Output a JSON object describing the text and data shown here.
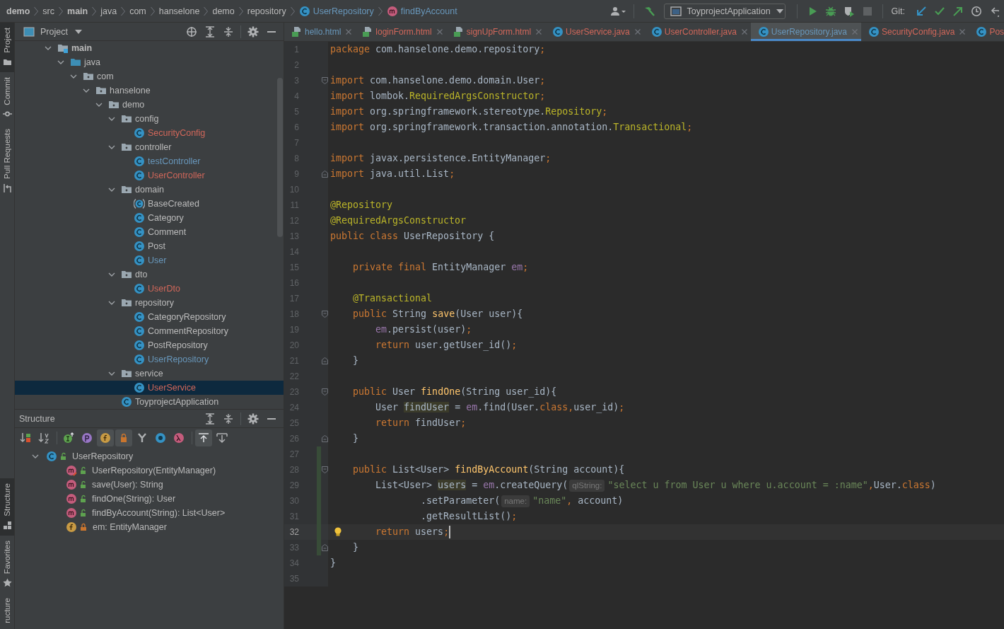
{
  "breadcrumbs": [
    {
      "label": "demo",
      "kind": "dir",
      "bold": true
    },
    {
      "label": "src",
      "kind": "dir",
      "bold": false
    },
    {
      "label": "main",
      "kind": "dir",
      "bold": true
    },
    {
      "label": "java",
      "kind": "dir",
      "bold": false
    },
    {
      "label": "com",
      "kind": "dir",
      "bold": false
    },
    {
      "label": "hanselone",
      "kind": "dir",
      "bold": false
    },
    {
      "label": "demo",
      "kind": "dir",
      "bold": false
    },
    {
      "label": "repository",
      "kind": "dir",
      "bold": false
    },
    {
      "label": "UserRepository",
      "kind": "class",
      "bold": false
    },
    {
      "label": "findByAccount",
      "kind": "method",
      "bold": false
    }
  ],
  "toolbar": [
    {
      "kind": "vcs-user",
      "disabled": false
    },
    {
      "kind": "build",
      "disabled": false
    },
    {
      "kind": "run-config",
      "label": "ToyprojectApplication",
      "disabled": false
    },
    {
      "kind": "run",
      "disabled": false
    },
    {
      "kind": "debug",
      "disabled": false
    },
    {
      "kind": "coverage",
      "disabled": false
    },
    {
      "kind": "stop",
      "disabled": true
    },
    {
      "kind": "git-label",
      "label": "Git:"
    },
    {
      "kind": "update",
      "disabled": false
    },
    {
      "kind": "commit",
      "disabled": false
    },
    {
      "kind": "push",
      "disabled": false
    },
    {
      "kind": "history",
      "disabled": false
    },
    {
      "kind": "rollback",
      "disabled": false
    }
  ],
  "tool_stripe": {
    "top": [
      {
        "label": "Project",
        "kind": "folder",
        "selected": true
      },
      {
        "label": "Commit",
        "kind": "commit",
        "selected": false
      },
      {
        "label": "Pull Requests",
        "kind": "pull",
        "selected": false
      }
    ],
    "bottom": [
      {
        "label": "Structure",
        "kind": "structure",
        "selected": true
      },
      {
        "label": "Favorites",
        "kind": "star",
        "selected": false
      },
      {
        "label": "ructure",
        "kind": "plain",
        "selected": false
      }
    ]
  },
  "project_panel": {
    "title": "Project",
    "tree": [
      {
        "label": "main",
        "kind": "module-folder",
        "color": "#bbbbbb",
        "selected": false,
        "expanded": true,
        "children": [
          {
            "label": "java",
            "kind": "source-root",
            "color": "#bbbbbb",
            "selected": false,
            "expanded": true,
            "children": [
              {
                "label": "com",
                "kind": "package",
                "color": "#bbbbbb",
                "selected": false,
                "expanded": true,
                "children": [
                  {
                    "label": "hanselone",
                    "kind": "package",
                    "color": "#bbbbbb",
                    "selected": false,
                    "expanded": true,
                    "children": [
                      {
                        "label": "demo",
                        "kind": "package",
                        "color": "#bbbbbb",
                        "selected": false,
                        "expanded": true,
                        "children": [
                          {
                            "label": "config",
                            "kind": "package",
                            "color": "#bbbbbb",
                            "selected": false,
                            "expanded": true,
                            "children": [
                              {
                                "label": "SecurityConfig",
                                "kind": "class",
                                "color": "#d1675a",
                                "selected": false
                              }
                            ]
                          },
                          {
                            "label": "controller",
                            "kind": "package",
                            "color": "#bbbbbb",
                            "selected": false,
                            "expanded": true,
                            "children": [
                              {
                                "label": "testController",
                                "kind": "class",
                                "color": "#6897bb",
                                "selected": false
                              },
                              {
                                "label": "UserController",
                                "kind": "class",
                                "color": "#d1675a",
                                "selected": false
                              }
                            ]
                          },
                          {
                            "label": "domain",
                            "kind": "package",
                            "color": "#bbbbbb",
                            "selected": false,
                            "expanded": true,
                            "children": [
                              {
                                "label": "BaseCreated",
                                "kind": "abstract-class",
                                "color": "#bbbbbb",
                                "selected": false
                              },
                              {
                                "label": "Category",
                                "kind": "class",
                                "color": "#bbbbbb",
                                "selected": false
                              },
                              {
                                "label": "Comment",
                                "kind": "class",
                                "color": "#bbbbbb",
                                "selected": false
                              },
                              {
                                "label": "Post",
                                "kind": "class",
                                "color": "#bbbbbb",
                                "selected": false
                              },
                              {
                                "label": "User",
                                "kind": "class",
                                "color": "#6897bb",
                                "selected": false
                              }
                            ]
                          },
                          {
                            "label": "dto",
                            "kind": "package",
                            "color": "#bbbbbb",
                            "selected": false,
                            "expanded": true,
                            "children": [
                              {
                                "label": "UserDto",
                                "kind": "class",
                                "color": "#d1675a",
                                "selected": false
                              }
                            ]
                          },
                          {
                            "label": "repository",
                            "kind": "package",
                            "color": "#bbbbbb",
                            "selected": false,
                            "expanded": true,
                            "children": [
                              {
                                "label": "CategoryRepository",
                                "kind": "class",
                                "color": "#bbbbbb",
                                "selected": false
                              },
                              {
                                "label": "CommentRepository",
                                "kind": "class",
                                "color": "#bbbbbb",
                                "selected": false
                              },
                              {
                                "label": "PostRepository",
                                "kind": "class",
                                "color": "#bbbbbb",
                                "selected": false
                              },
                              {
                                "label": "UserRepository",
                                "kind": "class",
                                "color": "#6897bb",
                                "selected": false
                              }
                            ]
                          },
                          {
                            "label": "service",
                            "kind": "package",
                            "color": "#bbbbbb",
                            "selected": false,
                            "expanded": true,
                            "children": [
                              {
                                "label": "UserService",
                                "kind": "class",
                                "color": "#d1675a",
                                "selected": true
                              }
                            ]
                          },
                          {
                            "label": "ToyprojectApplication",
                            "kind": "app-class",
                            "color": "#bbbbbb",
                            "selected": false
                          }
                        ]
                      }
                    ]
                  }
                ]
              }
            ]
          }
        ]
      }
    ]
  },
  "structure_panel": {
    "title": "Structure",
    "toolbar": [
      {
        "kind": "sort-visibility",
        "on": false
      },
      {
        "kind": "sort-alpha",
        "on": false
      },
      {
        "kind": "inherited",
        "on": false
      },
      {
        "kind": "properties",
        "on": false
      },
      {
        "kind": "fields",
        "on": true
      },
      {
        "kind": "non-public",
        "on": true
      },
      {
        "kind": "fork",
        "on": false
      },
      {
        "kind": "anonymous",
        "on": false
      },
      {
        "kind": "lambdas",
        "on": false
      },
      {
        "kind": "scroll-to-source",
        "on": true
      },
      {
        "kind": "scroll-from-source",
        "on": false
      }
    ],
    "tree": [
      {
        "label": "UserRepository",
        "kind": "class",
        "private": false,
        "selected": false,
        "expanded": true,
        "children": [
          {
            "label": "UserRepository(EntityManager)",
            "kind": "constructor",
            "private": false,
            "selected": false
          },
          {
            "label": "save(User): String",
            "kind": "method",
            "private": false,
            "selected": false
          },
          {
            "label": "findOne(String): User",
            "kind": "method",
            "private": false,
            "selected": false
          },
          {
            "label": "findByAccount(String): List<User>",
            "kind": "method",
            "private": false,
            "selected": false
          },
          {
            "label": "em: EntityManager",
            "kind": "field",
            "private": true,
            "selected": false
          }
        ]
      }
    ]
  },
  "editor": {
    "tabs": [
      {
        "label": "hello.html",
        "kind": "html",
        "color": "#6897bb",
        "selected": false,
        "closable": true
      },
      {
        "label": "loginForm.html",
        "kind": "html",
        "color": "#d1675a",
        "selected": false,
        "closable": true
      },
      {
        "label": "signUpForm.html",
        "kind": "html",
        "color": "#d1675a",
        "selected": false,
        "closable": true
      },
      {
        "label": "UserService.java",
        "kind": "class",
        "color": "#d1675a",
        "selected": false,
        "closable": true
      },
      {
        "label": "UserController.java",
        "kind": "class",
        "color": "#d1675a",
        "selected": false,
        "closable": true
      },
      {
        "label": "UserRepository.java",
        "kind": "class",
        "color": "#6897bb",
        "selected": true,
        "closable": true
      },
      {
        "label": "SecurityConfig.java",
        "kind": "class",
        "color": "#d1675a",
        "selected": false,
        "closable": true
      },
      {
        "label": "Pos",
        "kind": "class",
        "color": "#d1675a",
        "selected": false,
        "closable": false
      }
    ],
    "lines": [
      {
        "n": "1",
        "current": false,
        "changed": false,
        "fold_start": false,
        "fold_end": false,
        "intention": false,
        "tokens": [
          {
            "kind": "kw",
            "text": "package "
          },
          {
            "kind": "p",
            "text": "com.hanselone.demo.repository"
          },
          {
            "kind": "kw",
            "text": ";"
          }
        ]
      },
      {
        "n": "2",
        "current": false,
        "changed": false,
        "fold_start": false,
        "fold_end": false,
        "intention": false
      },
      {
        "n": "3",
        "current": false,
        "changed": false,
        "fold_start": true,
        "fold_end": false,
        "intention": false,
        "tokens": [
          {
            "kind": "kw",
            "text": "import "
          },
          {
            "kind": "p",
            "text": "com.hanselone.demo.domain.User"
          },
          {
            "kind": "kw",
            "text": ";"
          }
        ]
      },
      {
        "n": "4",
        "current": false,
        "changed": false,
        "fold_start": false,
        "fold_end": false,
        "intention": false,
        "tokens": [
          {
            "kind": "kw",
            "text": "import "
          },
          {
            "kind": "p",
            "text": "lombok."
          },
          {
            "kind": "ann",
            "text": "RequiredArgsConstructor"
          },
          {
            "kind": "kw",
            "text": ";"
          }
        ]
      },
      {
        "n": "5",
        "current": false,
        "changed": false,
        "fold_start": false,
        "fold_end": false,
        "intention": false,
        "tokens": [
          {
            "kind": "kw",
            "text": "import "
          },
          {
            "kind": "p",
            "text": "org.springframework.stereotype."
          },
          {
            "kind": "ann",
            "text": "Repository"
          },
          {
            "kind": "kw",
            "text": ";"
          }
        ]
      },
      {
        "n": "6",
        "current": false,
        "changed": false,
        "fold_start": false,
        "fold_end": false,
        "intention": false,
        "tokens": [
          {
            "kind": "kw",
            "text": "import "
          },
          {
            "kind": "p",
            "text": "org.springframework.transaction.annotation."
          },
          {
            "kind": "ann",
            "text": "Transactional"
          },
          {
            "kind": "kw",
            "text": ";"
          }
        ]
      },
      {
        "n": "7",
        "current": false,
        "changed": false,
        "fold_start": false,
        "fold_end": false,
        "intention": false
      },
      {
        "n": "8",
        "current": false,
        "changed": false,
        "fold_start": false,
        "fold_end": false,
        "intention": false,
        "tokens": [
          {
            "kind": "kw",
            "text": "import "
          },
          {
            "kind": "p",
            "text": "javax.persistence.EntityManager"
          },
          {
            "kind": "kw",
            "text": ";"
          }
        ]
      },
      {
        "n": "9",
        "current": false,
        "changed": false,
        "fold_start": false,
        "fold_end": true,
        "intention": false,
        "tokens": [
          {
            "kind": "kw",
            "text": "import "
          },
          {
            "kind": "p",
            "text": "java.util.List"
          },
          {
            "kind": "kw",
            "text": ";"
          }
        ]
      },
      {
        "n": "10",
        "current": false,
        "changed": false,
        "fold_start": false,
        "fold_end": false,
        "intention": false
      },
      {
        "n": "11",
        "current": false,
        "changed": false,
        "fold_start": false,
        "fold_end": false,
        "intention": false,
        "tokens": [
          {
            "kind": "ann",
            "text": "@Repository"
          }
        ]
      },
      {
        "n": "12",
        "current": false,
        "changed": false,
        "fold_start": false,
        "fold_end": false,
        "intention": false,
        "tokens": [
          {
            "kind": "ann",
            "text": "@RequiredArgsConstructor"
          }
        ]
      },
      {
        "n": "13",
        "current": false,
        "changed": false,
        "fold_start": false,
        "fold_end": false,
        "intention": false,
        "tokens": [
          {
            "kind": "kw",
            "text": "public class "
          },
          {
            "kind": "p",
            "text": "UserRepository {"
          }
        ]
      },
      {
        "n": "14",
        "current": false,
        "changed": false,
        "fold_start": false,
        "fold_end": false,
        "intention": false
      },
      {
        "n": "15",
        "current": false,
        "changed": false,
        "fold_start": false,
        "fold_end": false,
        "intention": false,
        "tokens": [
          {
            "kind": "kw",
            "text": "    private final "
          },
          {
            "kind": "p",
            "text": "EntityManager "
          },
          {
            "kind": "fld",
            "text": "em"
          },
          {
            "kind": "kw",
            "text": ";"
          }
        ]
      },
      {
        "n": "16",
        "current": false,
        "changed": false,
        "fold_start": false,
        "fold_end": false,
        "intention": false
      },
      {
        "n": "17",
        "current": false,
        "changed": false,
        "fold_start": false,
        "fold_end": false,
        "intention": false,
        "tokens": [
          {
            "kind": "ann",
            "text": "    @Transactional"
          }
        ]
      },
      {
        "n": "18",
        "current": false,
        "changed": false,
        "fold_start": true,
        "fold_end": false,
        "intention": false,
        "tokens": [
          {
            "kind": "kw",
            "text": "    public "
          },
          {
            "kind": "p",
            "text": "String "
          },
          {
            "kind": "meth",
            "text": "save"
          },
          {
            "kind": "p",
            "text": "(User user){"
          }
        ]
      },
      {
        "n": "19",
        "current": false,
        "changed": false,
        "fold_start": false,
        "fold_end": false,
        "intention": false,
        "tokens": [
          {
            "kind": "fld",
            "text": "        em"
          },
          {
            "kind": "p",
            "text": ".persist(user)"
          },
          {
            "kind": "kw",
            "text": ";"
          }
        ]
      },
      {
        "n": "20",
        "current": false,
        "changed": false,
        "fold_start": false,
        "fold_end": false,
        "intention": false,
        "tokens": [
          {
            "kind": "kw",
            "text": "        return "
          },
          {
            "kind": "p",
            "text": "user.getUser_id()"
          },
          {
            "kind": "kw",
            "text": ";"
          }
        ]
      },
      {
        "n": "21",
        "current": false,
        "changed": false,
        "fold_start": false,
        "fold_end": true,
        "intention": false,
        "tokens": [
          {
            "kind": "p",
            "text": "    }"
          }
        ]
      },
      {
        "n": "22",
        "current": false,
        "changed": false,
        "fold_start": false,
        "fold_end": false,
        "intention": false
      },
      {
        "n": "23",
        "current": false,
        "changed": false,
        "fold_start": true,
        "fold_end": false,
        "intention": false,
        "tokens": [
          {
            "kind": "kw",
            "text": "    public "
          },
          {
            "kind": "p",
            "text": "User "
          },
          {
            "kind": "meth",
            "text": "findOne"
          },
          {
            "kind": "p",
            "text": "(String user_id){"
          }
        ]
      },
      {
        "n": "24",
        "current": false,
        "changed": false,
        "fold_start": false,
        "fold_end": false,
        "intention": false,
        "tokens": [
          {
            "kind": "p",
            "text": "        User "
          },
          {
            "kind": "hl",
            "text": "findUser"
          },
          {
            "kind": "p",
            "text": " = "
          },
          {
            "kind": "fld",
            "text": "em"
          },
          {
            "kind": "p",
            "text": ".find(User."
          },
          {
            "kind": "kw",
            "text": "class,"
          },
          {
            "kind": "p",
            "text": "user_id)"
          },
          {
            "kind": "kw",
            "text": ";"
          }
        ]
      },
      {
        "n": "25",
        "current": false,
        "changed": false,
        "fold_start": false,
        "fold_end": false,
        "intention": false,
        "tokens": [
          {
            "kind": "kw",
            "text": "        return "
          },
          {
            "kind": "p",
            "text": "findUser"
          },
          {
            "kind": "kw",
            "text": ";"
          }
        ]
      },
      {
        "n": "26",
        "current": false,
        "changed": false,
        "fold_start": false,
        "fold_end": true,
        "intention": false,
        "tokens": [
          {
            "kind": "p",
            "text": "    }"
          }
        ]
      },
      {
        "n": "27",
        "current": false,
        "changed": true,
        "fold_start": false,
        "fold_end": false,
        "intention": false
      },
      {
        "n": "28",
        "current": false,
        "changed": true,
        "fold_start": true,
        "fold_end": false,
        "intention": false,
        "tokens": [
          {
            "kind": "kw",
            "text": "    public "
          },
          {
            "kind": "p",
            "text": "List<User> "
          },
          {
            "kind": "meth",
            "text": "findByAccount"
          },
          {
            "kind": "p",
            "text": "(String account){"
          }
        ]
      },
      {
        "n": "29",
        "current": false,
        "changed": true,
        "fold_start": false,
        "fold_end": false,
        "intention": false,
        "tokens": [
          {
            "kind": "p",
            "text": "        List<User> "
          },
          {
            "kind": "hl",
            "text": "users"
          },
          {
            "kind": "p",
            "text": " = "
          },
          {
            "kind": "fld",
            "text": "em"
          },
          {
            "kind": "p",
            "text": ".createQuery("
          },
          {
            "kind": "hint",
            "text": "qlString:"
          },
          {
            "kind": "str",
            "text": "\"select u from User u where u.account = :name\""
          },
          {
            "kind": "kw",
            "text": ","
          },
          {
            "kind": "p",
            "text": "User."
          },
          {
            "kind": "kw",
            "text": "class"
          },
          {
            "kind": "p",
            "text": ")"
          }
        ]
      },
      {
        "n": "30",
        "current": false,
        "changed": true,
        "fold_start": false,
        "fold_end": false,
        "intention": false,
        "tokens": [
          {
            "kind": "p",
            "text": "                .setParameter("
          },
          {
            "kind": "hint",
            "text": "name:"
          },
          {
            "kind": "str",
            "text": "\"name\""
          },
          {
            "kind": "kw",
            "text": ", "
          },
          {
            "kind": "p",
            "text": "account)"
          }
        ]
      },
      {
        "n": "31",
        "current": false,
        "changed": true,
        "fold_start": false,
        "fold_end": false,
        "intention": false,
        "tokens": [
          {
            "kind": "p",
            "text": "                .getResultList()"
          },
          {
            "kind": "kw",
            "text": ";"
          }
        ]
      },
      {
        "n": "32",
        "current": true,
        "changed": true,
        "fold_start": false,
        "fold_end": false,
        "intention": true,
        "tokens": [
          {
            "kind": "kw",
            "text": "        return "
          },
          {
            "kind": "p",
            "text": "users"
          },
          {
            "kind": "kw",
            "text": ";"
          }
        ]
      },
      {
        "n": "33",
        "current": false,
        "changed": true,
        "fold_start": false,
        "fold_end": true,
        "intention": false,
        "tokens": [
          {
            "kind": "p",
            "text": "    }"
          }
        ]
      },
      {
        "n": "34",
        "current": false,
        "changed": false,
        "fold_start": false,
        "fold_end": false,
        "intention": false,
        "tokens": [
          {
            "kind": "p",
            "text": "}"
          }
        ]
      },
      {
        "n": "35",
        "current": false,
        "changed": false,
        "fold_start": false,
        "fold_end": false,
        "intention": false
      }
    ]
  }
}
